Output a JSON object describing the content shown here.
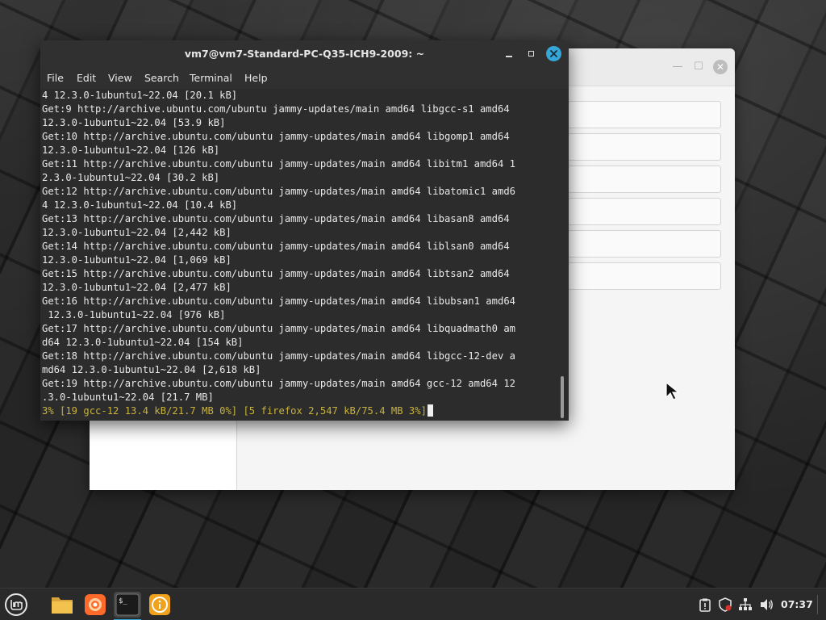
{
  "terminal": {
    "title": "vm7@vm7-Standard-PC-Q35-ICH9-2009: ~",
    "menu": [
      "File",
      "Edit",
      "Search",
      "Terminal",
      "Help"
    ],
    "lines": [
      "4 12.3.0-1ubuntu1~22.04 [20.1 kB]",
      "Get:9 http://archive.ubuntu.com/ubuntu jammy-updates/main amd64 libgcc-s1 amd64",
      "12.3.0-1ubuntu1~22.04 [53.9 kB]",
      "Get:10 http://archive.ubuntu.com/ubuntu jammy-updates/main amd64 libgomp1 amd64",
      "12.3.0-1ubuntu1~22.04 [126 kB]",
      "Get:11 http://archive.ubuntu.com/ubuntu jammy-updates/main amd64 libitm1 amd64 1",
      "2.3.0-1ubuntu1~22.04 [30.2 kB]",
      "Get:12 http://archive.ubuntu.com/ubuntu jammy-updates/main amd64 libatomic1 amd6",
      "4 12.3.0-1ubuntu1~22.04 [10.4 kB]",
      "Get:13 http://archive.ubuntu.com/ubuntu jammy-updates/main amd64 libasan8 amd64",
      "12.3.0-1ubuntu1~22.04 [2,442 kB]",
      "Get:14 http://archive.ubuntu.com/ubuntu jammy-updates/main amd64 liblsan0 amd64",
      "12.3.0-1ubuntu1~22.04 [1,069 kB]",
      "Get:15 http://archive.ubuntu.com/ubuntu jammy-updates/main amd64 libtsan2 amd64",
      "12.3.0-1ubuntu1~22.04 [2,477 kB]",
      "Get:16 http://archive.ubuntu.com/ubuntu jammy-updates/main amd64 libubsan1 amd64",
      " 12.3.0-1ubuntu1~22.04 [976 kB]",
      "Get:17 http://archive.ubuntu.com/ubuntu jammy-updates/main amd64 libquadmath0 am",
      "d64 12.3.0-1ubuntu1~22.04 [154 kB]",
      "Get:18 http://archive.ubuntu.com/ubuntu jammy-updates/main amd64 libgcc-12-dev a",
      "md64 12.3.0-1ubuntu1~22.04 [2,618 kB]",
      "Get:19 http://archive.ubuntu.com/ubuntu jammy-updates/main amd64 gcc-12 amd64 12",
      ".3.0-1ubuntu1~22.04 [21.7 MB]"
    ],
    "progress_line": "3% [19 gcc-12 13.4 kB/21.7 MB 0%] [5 firefox 2,547 kB/75.4 MB 3%]"
  },
  "taskbar": {
    "apps": [
      {
        "name": "files-app",
        "icon": "folder-icon"
      },
      {
        "name": "firefox-app",
        "icon": "firefox-icon"
      },
      {
        "name": "terminal-app",
        "icon": "terminal-icon"
      },
      {
        "name": "info-app",
        "icon": "info-icon"
      }
    ],
    "tray": [
      "clipboard-icon",
      "shield-icon",
      "network-icon",
      "volume-icon"
    ],
    "clock": "07:37"
  },
  "colors": {
    "accent": "#35a6d8",
    "progress": "#c8b23c",
    "terminal_bg": "#2c2c2c"
  }
}
